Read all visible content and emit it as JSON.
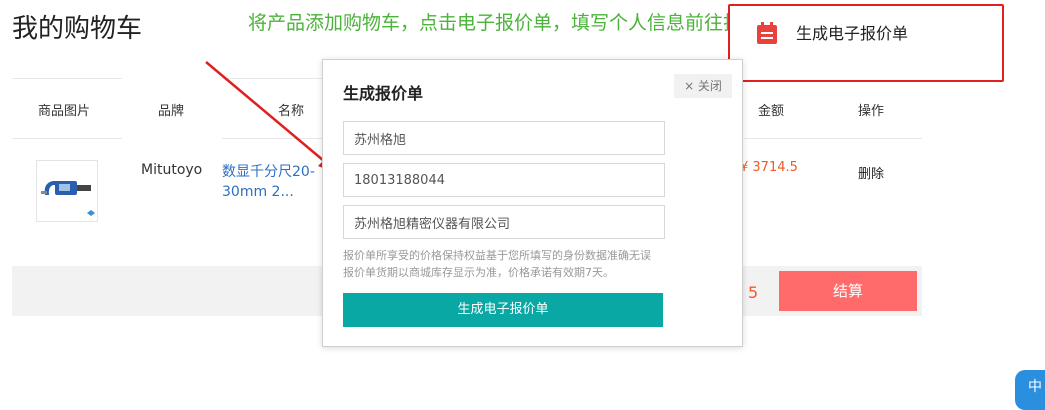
{
  "page": {
    "title": "我的购物车"
  },
  "annotation": {
    "text": "将产品添加购物车，点击电子报价单，填写个人信息前往打印"
  },
  "table": {
    "headers": [
      "商品图片",
      "品牌",
      "名称",
      "金额",
      "操作"
    ]
  },
  "cart_item": {
    "brand": "Mitutoyo",
    "name": "数显千分尺20-30mm 2...",
    "amount": "¥ 3714.5",
    "delete_label": "删除"
  },
  "footer": {
    "total_partial": "5",
    "checkout_label": "结算"
  },
  "generate_quote": {
    "label": "生成电子报价单"
  },
  "modal": {
    "title": "生成报价单",
    "close_label": "× 关闭",
    "fields": {
      "company_short": "苏州格旭",
      "phone": "18013188044",
      "company_full": "苏州格旭精密仪器有限公司"
    },
    "note_line1": "报价单所享受的价格保持权益基于您所填写的身份数据准确无误",
    "note_line2": "报价单货期以商城库存显示为准，价格承诺有效期7天。",
    "submit_label": "生成电子报价单"
  },
  "chat_widget": {
    "label": "中"
  },
  "colors": {
    "accent_teal": "#0aa8a5",
    "checkout_red": "#ff6a6a",
    "price_orange": "#f05a28",
    "highlight_red": "#e02020",
    "annotation_green": "#4bb33a"
  }
}
